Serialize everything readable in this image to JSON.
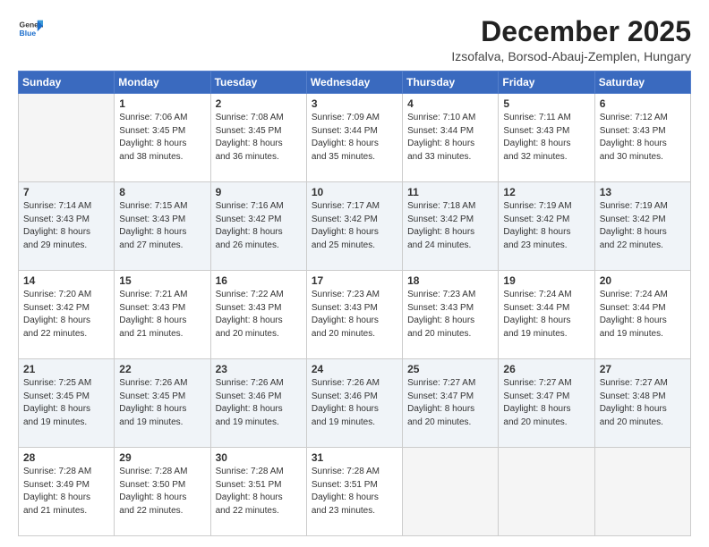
{
  "logo": {
    "line1": "General",
    "line2": "Blue"
  },
  "title": "December 2025",
  "subtitle": "Izsofalva, Borsod-Abauj-Zemplen, Hungary",
  "weekdays": [
    "Sunday",
    "Monday",
    "Tuesday",
    "Wednesday",
    "Thursday",
    "Friday",
    "Saturday"
  ],
  "weeks": [
    [
      {
        "day": "",
        "info": ""
      },
      {
        "day": "1",
        "info": "Sunrise: 7:06 AM\nSunset: 3:45 PM\nDaylight: 8 hours\nand 38 minutes."
      },
      {
        "day": "2",
        "info": "Sunrise: 7:08 AM\nSunset: 3:45 PM\nDaylight: 8 hours\nand 36 minutes."
      },
      {
        "day": "3",
        "info": "Sunrise: 7:09 AM\nSunset: 3:44 PM\nDaylight: 8 hours\nand 35 minutes."
      },
      {
        "day": "4",
        "info": "Sunrise: 7:10 AM\nSunset: 3:44 PM\nDaylight: 8 hours\nand 33 minutes."
      },
      {
        "day": "5",
        "info": "Sunrise: 7:11 AM\nSunset: 3:43 PM\nDaylight: 8 hours\nand 32 minutes."
      },
      {
        "day": "6",
        "info": "Sunrise: 7:12 AM\nSunset: 3:43 PM\nDaylight: 8 hours\nand 30 minutes."
      }
    ],
    [
      {
        "day": "7",
        "info": "Sunrise: 7:14 AM\nSunset: 3:43 PM\nDaylight: 8 hours\nand 29 minutes."
      },
      {
        "day": "8",
        "info": "Sunrise: 7:15 AM\nSunset: 3:43 PM\nDaylight: 8 hours\nand 27 minutes."
      },
      {
        "day": "9",
        "info": "Sunrise: 7:16 AM\nSunset: 3:42 PM\nDaylight: 8 hours\nand 26 minutes."
      },
      {
        "day": "10",
        "info": "Sunrise: 7:17 AM\nSunset: 3:42 PM\nDaylight: 8 hours\nand 25 minutes."
      },
      {
        "day": "11",
        "info": "Sunrise: 7:18 AM\nSunset: 3:42 PM\nDaylight: 8 hours\nand 24 minutes."
      },
      {
        "day": "12",
        "info": "Sunrise: 7:19 AM\nSunset: 3:42 PM\nDaylight: 8 hours\nand 23 minutes."
      },
      {
        "day": "13",
        "info": "Sunrise: 7:19 AM\nSunset: 3:42 PM\nDaylight: 8 hours\nand 22 minutes."
      }
    ],
    [
      {
        "day": "14",
        "info": "Sunrise: 7:20 AM\nSunset: 3:42 PM\nDaylight: 8 hours\nand 22 minutes."
      },
      {
        "day": "15",
        "info": "Sunrise: 7:21 AM\nSunset: 3:43 PM\nDaylight: 8 hours\nand 21 minutes."
      },
      {
        "day": "16",
        "info": "Sunrise: 7:22 AM\nSunset: 3:43 PM\nDaylight: 8 hours\nand 20 minutes."
      },
      {
        "day": "17",
        "info": "Sunrise: 7:23 AM\nSunset: 3:43 PM\nDaylight: 8 hours\nand 20 minutes."
      },
      {
        "day": "18",
        "info": "Sunrise: 7:23 AM\nSunset: 3:43 PM\nDaylight: 8 hours\nand 20 minutes."
      },
      {
        "day": "19",
        "info": "Sunrise: 7:24 AM\nSunset: 3:44 PM\nDaylight: 8 hours\nand 19 minutes."
      },
      {
        "day": "20",
        "info": "Sunrise: 7:24 AM\nSunset: 3:44 PM\nDaylight: 8 hours\nand 19 minutes."
      }
    ],
    [
      {
        "day": "21",
        "info": "Sunrise: 7:25 AM\nSunset: 3:45 PM\nDaylight: 8 hours\nand 19 minutes."
      },
      {
        "day": "22",
        "info": "Sunrise: 7:26 AM\nSunset: 3:45 PM\nDaylight: 8 hours\nand 19 minutes."
      },
      {
        "day": "23",
        "info": "Sunrise: 7:26 AM\nSunset: 3:46 PM\nDaylight: 8 hours\nand 19 minutes."
      },
      {
        "day": "24",
        "info": "Sunrise: 7:26 AM\nSunset: 3:46 PM\nDaylight: 8 hours\nand 19 minutes."
      },
      {
        "day": "25",
        "info": "Sunrise: 7:27 AM\nSunset: 3:47 PM\nDaylight: 8 hours\nand 20 minutes."
      },
      {
        "day": "26",
        "info": "Sunrise: 7:27 AM\nSunset: 3:47 PM\nDaylight: 8 hours\nand 20 minutes."
      },
      {
        "day": "27",
        "info": "Sunrise: 7:27 AM\nSunset: 3:48 PM\nDaylight: 8 hours\nand 20 minutes."
      }
    ],
    [
      {
        "day": "28",
        "info": "Sunrise: 7:28 AM\nSunset: 3:49 PM\nDaylight: 8 hours\nand 21 minutes."
      },
      {
        "day": "29",
        "info": "Sunrise: 7:28 AM\nSunset: 3:50 PM\nDaylight: 8 hours\nand 22 minutes."
      },
      {
        "day": "30",
        "info": "Sunrise: 7:28 AM\nSunset: 3:51 PM\nDaylight: 8 hours\nand 22 minutes."
      },
      {
        "day": "31",
        "info": "Sunrise: 7:28 AM\nSunset: 3:51 PM\nDaylight: 8 hours\nand 23 minutes."
      },
      {
        "day": "",
        "info": ""
      },
      {
        "day": "",
        "info": ""
      },
      {
        "day": "",
        "info": ""
      }
    ]
  ]
}
